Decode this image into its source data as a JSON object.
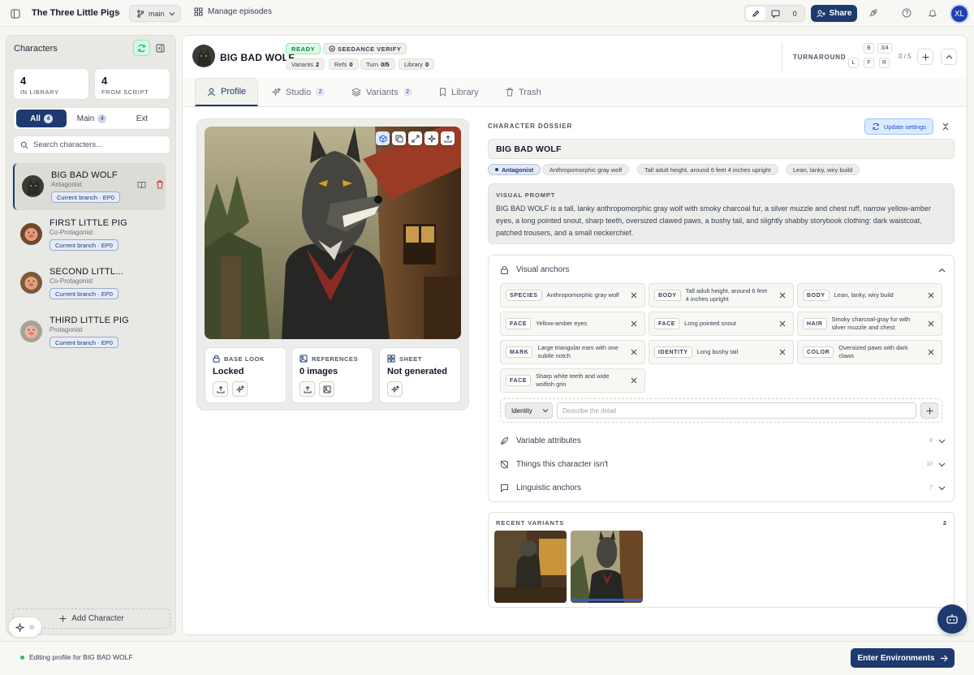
{
  "topbar": {
    "project_title": "The Three Little Pigs",
    "branch": "main",
    "manage_label": "Manage episodes",
    "comment_count": "0",
    "share_label": "Share",
    "user_initials": "XL"
  },
  "sidebar": {
    "title": "Characters",
    "stats": [
      {
        "value": "4",
        "label": "IN LIBRARY"
      },
      {
        "value": "4",
        "label": "FROM SCRIPT"
      }
    ],
    "filters": [
      {
        "label": "All",
        "count": "4"
      },
      {
        "label": "Main",
        "count": "4"
      },
      {
        "label": "Ext",
        "count": ""
      }
    ],
    "search_placeholder": "Search characters...",
    "characters": [
      {
        "name": "BIG BAD WOLF",
        "role": "Antagonist",
        "branch": "Current branch · EP0"
      },
      {
        "name": "FIRST LITTLE PIG",
        "role": "Co-Protagonist",
        "branch": "Current branch · EP0"
      },
      {
        "name": "SECOND LITTL...",
        "role": "Co-Protagonist",
        "branch": "Current branch · EP0"
      },
      {
        "name": "THIRD LITTLE PIG",
        "role": "Protagonist",
        "branch": "Current branch · EP0"
      }
    ],
    "add_label": "Add Character"
  },
  "header": {
    "name": "BIG BAD WOLF",
    "status": "READY",
    "verify": "SEEDANCE VERIFY",
    "meta": [
      {
        "label": "Variants",
        "value": "2"
      },
      {
        "label": "Refs",
        "value": "0"
      },
      {
        "label": "Turn",
        "value": "0/5"
      },
      {
        "label": "Library",
        "value": "0"
      }
    ],
    "turnaround_label": "TURNAROUND",
    "turnaround_keys": [
      "B",
      "3/4",
      "L",
      "F",
      "R"
    ],
    "turnaround_count": "0 / 5"
  },
  "tabs": [
    {
      "label": "Profile",
      "count": ""
    },
    {
      "label": "Studio",
      "count": "2"
    },
    {
      "label": "Variants",
      "count": "2"
    },
    {
      "label": "Library",
      "count": ""
    },
    {
      "label": "Trash",
      "count": ""
    }
  ],
  "cards": [
    {
      "label": "BASE LOOK",
      "value": "Locked"
    },
    {
      "label": "REFERENCES",
      "value": "0 images"
    },
    {
      "label": "SHEET",
      "value": "Not generated"
    }
  ],
  "dossier": {
    "label": "CHARACTER DOSSIER",
    "update_label": "Update settings",
    "name": "BIG BAD WOLF",
    "tags": [
      "Antagonist",
      "Anthropomorphic gray wolf",
      "Tall adult height, around 6 feet 4 inches upright",
      "Lean, lanky, wiry build"
    ],
    "visual_prompt_label": "VISUAL PROMPT",
    "visual_prompt": "BIG BAD WOLF is a tall, lanky anthropomorphic gray wolf with smoky charcoal fur, a silver muzzle and chest ruff, narrow yellow-amber eyes, a long pointed snout, sharp teeth, oversized clawed paws, a bushy tail, and slightly shabby storybook clothing: dark waistcoat, patched trousers, and a small neckerchief.",
    "anchors_title": "Visual anchors",
    "anchors": [
      {
        "key": "SPECIES",
        "value": "Anthropomorphic gray wolf"
      },
      {
        "key": "BODY",
        "value": "Tall adult height, around 6 feet 4 inches upright"
      },
      {
        "key": "BODY",
        "value": "Lean, lanky, wiry build"
      },
      {
        "key": "FACE",
        "value": "Yellow-amber eyes"
      },
      {
        "key": "FACE",
        "value": "Long pointed snout"
      },
      {
        "key": "HAIR",
        "value": "Smoky charcoal-gray fur with silver muzzle and chest"
      },
      {
        "key": "MARK",
        "value": "Large triangular ears with one subtle notch"
      },
      {
        "key": "IDENTITY",
        "value": "Long bushy tail"
      },
      {
        "key": "COLOR",
        "value": "Oversized paws with dark claws"
      },
      {
        "key": "FACE",
        "value": "Sharp white teeth and wide wolfish grin"
      }
    ],
    "new_anchor_type": "Identity",
    "new_anchor_placeholder": "Describe the detail",
    "sections": [
      {
        "label": "Variable attributes",
        "count": "8"
      },
      {
        "label": "Things this character isn't",
        "count": "10"
      },
      {
        "label": "Linguistic anchors",
        "count": "7"
      }
    ],
    "recent_label": "RECENT VARIANTS",
    "recent_count": "2"
  },
  "status": {
    "text": "Editing profile for BIG BAD WOLF",
    "cta": "Enter Environments"
  },
  "colors": {
    "brand": "#1e3a6e",
    "ready": "#15803d",
    "danger": "#dc2626",
    "link": "#1d4ed8"
  }
}
